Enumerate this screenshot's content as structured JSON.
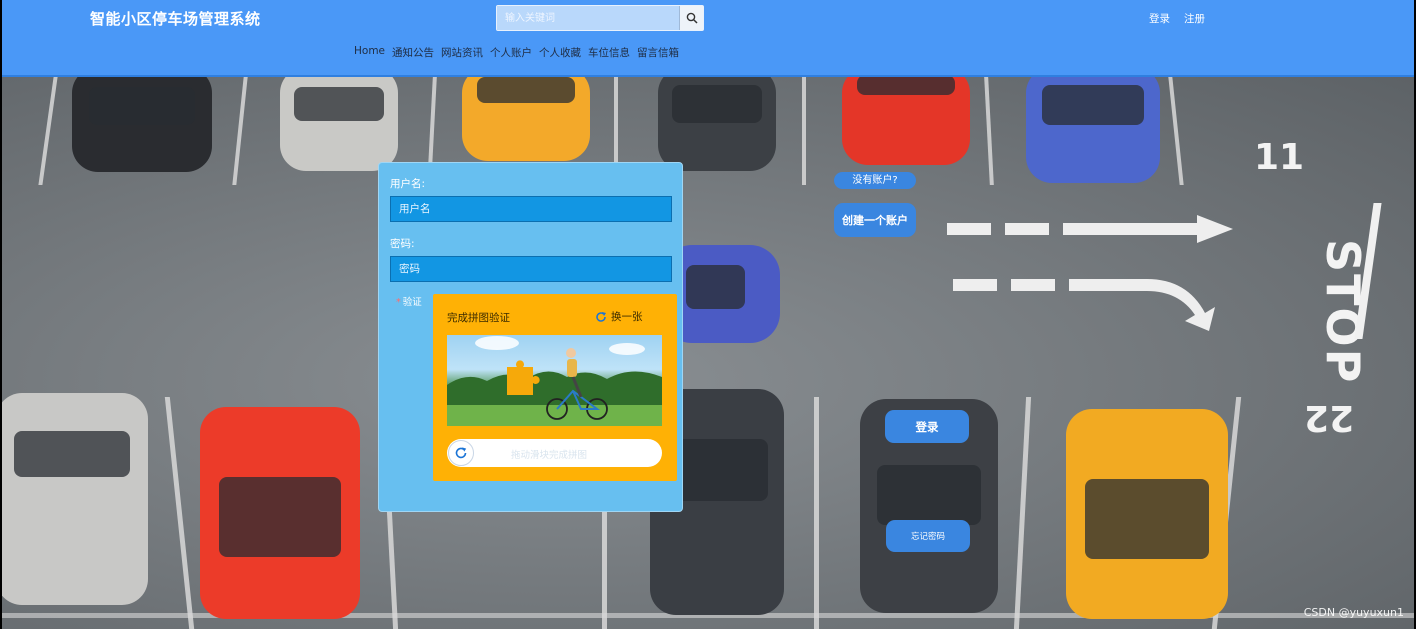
{
  "header": {
    "site_title": "智能小区停车场管理系统",
    "search_placeholder": "输入关键词",
    "auth_links": [
      "登录",
      "注册"
    ],
    "nav_items": [
      "Home",
      "通知公告",
      "网站资讯",
      "个人账户",
      "个人收藏",
      "车位信息",
      "留言信箱"
    ]
  },
  "background": {
    "road_numbers": [
      "11",
      "22"
    ],
    "road_word": "STOP"
  },
  "login_form": {
    "username_label": "用户名:",
    "username_placeholder": "用户名",
    "password_label": "密码:",
    "password_placeholder": "密码",
    "verify_star": "*",
    "verify_label": "验证",
    "captcha": {
      "title": "完成拼图验证",
      "refresh_label": "换一张",
      "slider_hint": "拖动滑块完成拼图"
    }
  },
  "side_actions": {
    "no_account_text": "没有账户?",
    "create_account_label": "创建一个账户",
    "login_button_label": "登录",
    "forgot_password_label": "忘记密码"
  },
  "watermark": "CSDN @yuyuxun1",
  "colors": {
    "header_bg": "#4a98f7",
    "panel_bg": "#67bff0",
    "input_bg": "#1296e3",
    "captcha_bg": "#ffb105",
    "button_bg": "#3a86e0"
  }
}
